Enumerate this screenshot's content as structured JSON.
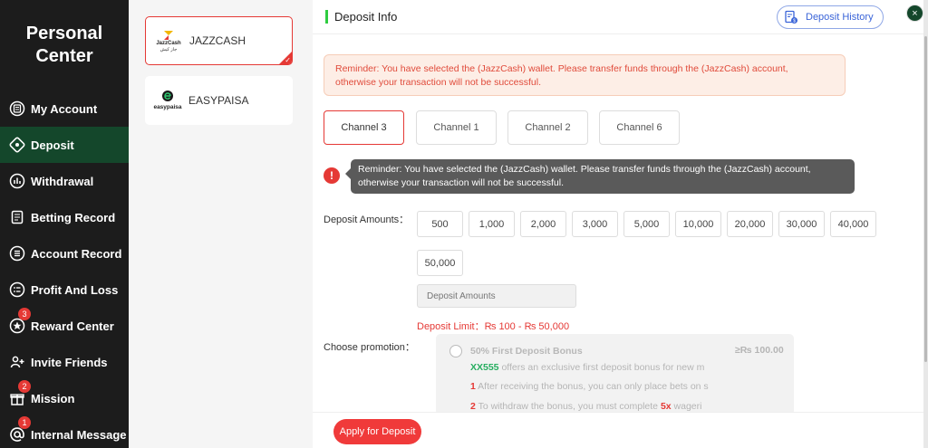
{
  "sidebar": {
    "title_line1": "Personal",
    "title_line2": "Center",
    "items": [
      {
        "label": "My Account",
        "icon": "account-icon"
      },
      {
        "label": "Deposit",
        "icon": "deposit-icon"
      },
      {
        "label": "Withdrawal",
        "icon": "withdrawal-icon"
      },
      {
        "label": "Betting Record",
        "icon": "betting-record-icon"
      },
      {
        "label": "Account Record",
        "icon": "account-record-icon"
      },
      {
        "label": "Profit And Loss",
        "icon": "profit-loss-icon"
      },
      {
        "label": "Reward Center",
        "icon": "reward-icon",
        "badge": "3"
      },
      {
        "label": "Invite Friends",
        "icon": "invite-icon"
      },
      {
        "label": "Mission",
        "icon": "gift-icon",
        "badge": "2"
      },
      {
        "label": "Internal Message",
        "icon": "at-icon",
        "badge": "1"
      }
    ]
  },
  "wallets": [
    {
      "label": "JAZZCASH",
      "logo_text": "JazzCash",
      "logo_sub": "جاز کیش"
    },
    {
      "label": "EASYPAISA",
      "logo_text": "easypaisa"
    }
  ],
  "header": {
    "title": "Deposit Info",
    "history_label": "Deposit History",
    "close_label": "×"
  },
  "reminder": {
    "line1": "Reminder: You have selected the (JazzCash) wallet. Please transfer funds through the (JazzCash) account,",
    "line2": "otherwise your transaction will not be successful."
  },
  "channels": [
    "Channel 3",
    "Channel 1",
    "Channel 2",
    "Channel 6"
  ],
  "tooltip": {
    "line1": "Reminder: You have selected the (JazzCash) wallet. Please transfer funds through the (JazzCash) account,",
    "line2": "otherwise your transaction will not be successful."
  },
  "deposit": {
    "amounts_label": "Deposit Amounts：",
    "amounts": [
      "500",
      "1,000",
      "2,000",
      "3,000",
      "5,000",
      "10,000",
      "20,000",
      "30,000",
      "40,000",
      "50,000"
    ],
    "input_placeholder": "Deposit Amounts",
    "limit_text": "Deposit Limit：₨ 100 - ₨ 50,000"
  },
  "promotion": {
    "label": "Choose promotion：",
    "title": "50% First Deposit Bonus",
    "min": "≥₨ 100.00",
    "brand": "XX555",
    "desc": " offers an exclusive first deposit bonus for new m",
    "rule1_num": "1",
    "rule1": " After receiving the bonus, you can only place bets on s",
    "rule2_num": "2",
    "rule2_a": " To withdraw the bonus, you must complete ",
    "rule2_mult": "5x",
    "rule2_b": " wageri"
  },
  "footer": {
    "apply_label": "Apply for Deposit"
  },
  "colors": {
    "accent": "#e53935",
    "sidebar_bg": "#1c1c1c",
    "sidebar_active": "#14472b",
    "link_blue": "#3a64d8"
  }
}
